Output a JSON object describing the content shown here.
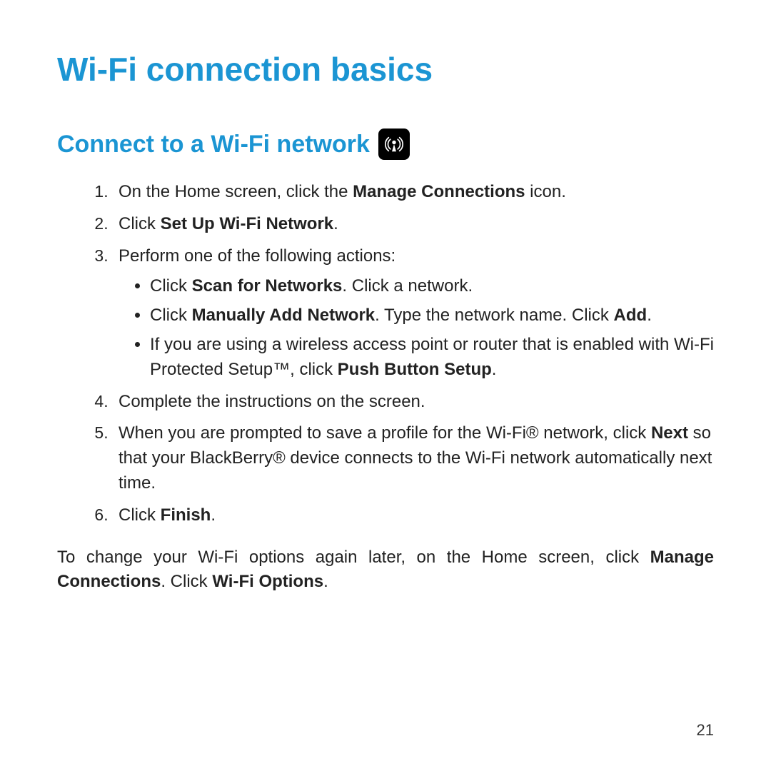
{
  "title": "Wi-Fi connection basics",
  "subtitle": "Connect to a Wi-Fi network",
  "icon_name": "wifi-antenna-icon",
  "steps": {
    "s1_a": "On the Home screen, click the ",
    "s1_b": "Manage Connections",
    "s1_c": " icon.",
    "s2_a": "Click ",
    "s2_b": "Set Up Wi-Fi Network",
    "s2_c": ".",
    "s3": "Perform one of the following actions:",
    "s3_i1_a": "Click ",
    "s3_i1_b": "Scan for Networks",
    "s3_i1_c": ". Click a network.",
    "s3_i2_a": "Click ",
    "s3_i2_b": "Manually Add Network",
    "s3_i2_c": ". Type the network name. Click ",
    "s3_i2_d": "Add",
    "s3_i2_e": ".",
    "s3_i3_a": "If you are using a wireless access point or router that is enabled with Wi-Fi Protected Setup™, click ",
    "s3_i3_b": "Push Button Setup",
    "s3_i3_c": ".",
    "s4": "Complete the instructions on the screen.",
    "s5_a": "When you are prompted to save a profile for the Wi-Fi® network, click ",
    "s5_b": "Next",
    "s5_c": " so that your BlackBerry® device connects to the Wi-Fi network automatically next time.",
    "s6_a": "Click ",
    "s6_b": "Finish",
    "s6_c": "."
  },
  "after": {
    "a": "To change your Wi-Fi options again later, on the Home screen, click ",
    "b": "Manage Connections",
    "c": ". Click ",
    "d": "Wi-Fi Options",
    "e": "."
  },
  "page_number": "21"
}
